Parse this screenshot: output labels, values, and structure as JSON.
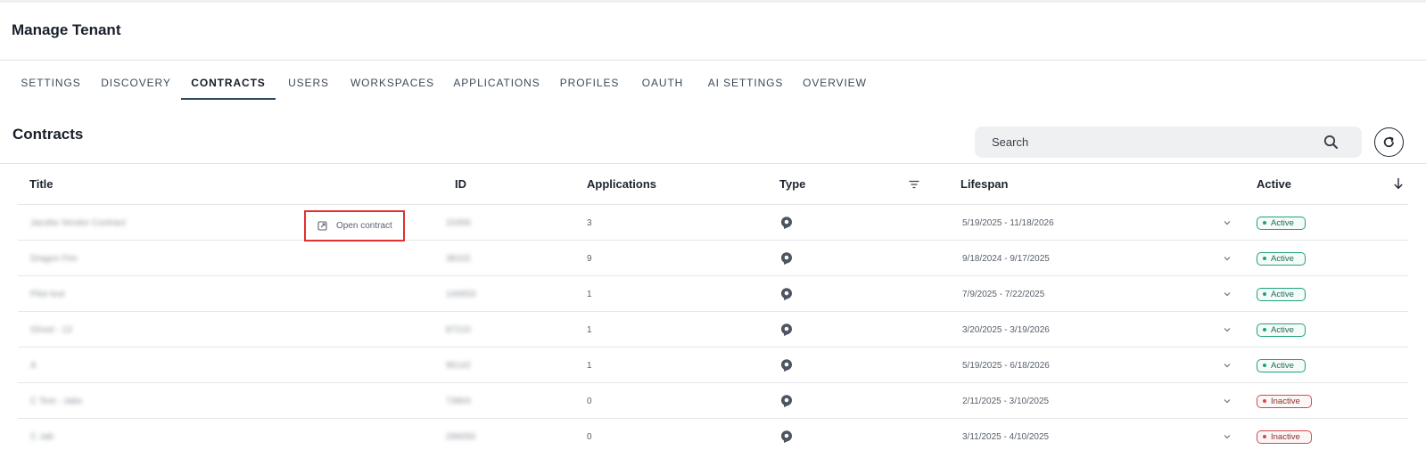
{
  "header": {
    "title": "Manage Tenant"
  },
  "tabs": [
    {
      "label": "SETTINGS",
      "active": false
    },
    {
      "label": "DISCOVERY",
      "active": false
    },
    {
      "label": "CONTRACTS",
      "active": true
    },
    {
      "label": "USERS",
      "active": false
    },
    {
      "label": "WORKSPACES",
      "active": false
    },
    {
      "label": "APPLICATIONS",
      "active": false
    },
    {
      "label": "PROFILES",
      "active": false
    },
    {
      "label": "OAUTH",
      "active": false
    },
    {
      "label": "AI SETTINGS",
      "active": false
    },
    {
      "label": "OVERVIEW",
      "active": false
    }
  ],
  "section": {
    "title": "Contracts"
  },
  "search": {
    "placeholder": "Search",
    "value": ""
  },
  "table": {
    "columns": {
      "title": "Title",
      "id": "ID",
      "applications": "Applications",
      "type": "Type",
      "lifespan": "Lifespan",
      "active": "Active"
    },
    "rows": [
      {
        "title": "Jacobs Vendor Contract",
        "id": "10456",
        "applications": "3",
        "lifespan": "5/19/2025 - 11/18/2026",
        "status": "Active",
        "active": true
      },
      {
        "title": "Dragon Fire",
        "id": "38102",
        "applications": "9",
        "lifespan": "9/18/2024 - 9/17/2025",
        "status": "Active",
        "active": true
      },
      {
        "title": "Pilot test",
        "id": "140653",
        "applications": "1",
        "lifespan": "7/9/2025 - 7/22/2025",
        "status": "Active",
        "active": true
      },
      {
        "title": "Ghost - 13",
        "id": "87210",
        "applications": "1",
        "lifespan": "3/20/2025 - 3/19/2026",
        "status": "Active",
        "active": true
      },
      {
        "title": "A",
        "id": "95142",
        "applications": "1",
        "lifespan": "5/19/2025 - 6/18/2026",
        "status": "Active",
        "active": true
      },
      {
        "title": "C Test - Jabs",
        "id": "73804",
        "applications": "0",
        "lifespan": "2/11/2025 - 3/10/2025",
        "status": "Inactive",
        "active": false
      },
      {
        "title": "C Jab",
        "id": "296050",
        "applications": "0",
        "lifespan": "3/11/2025 - 4/10/2025",
        "status": "Inactive",
        "active": false
      }
    ]
  },
  "row_action": {
    "label": "Open contract",
    "icon": "open-external-icon"
  },
  "colors": {
    "accent": "#2e4761",
    "active": "#1fa27c",
    "inactive": "#d24b4b",
    "highlight": "#e0312f"
  }
}
